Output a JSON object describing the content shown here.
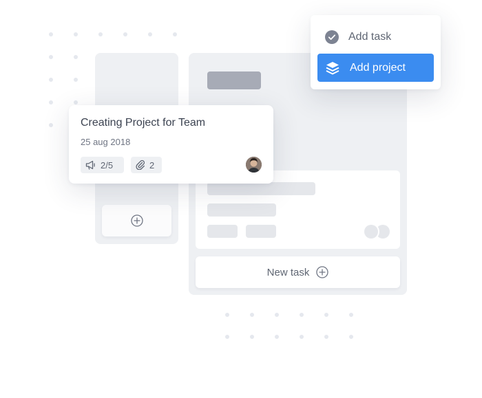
{
  "menu": {
    "items": [
      {
        "label": "Add task",
        "icon": "check-circle-icon"
      },
      {
        "label": "Add project",
        "icon": "layers-icon",
        "active": true
      }
    ]
  },
  "card": {
    "title": "Creating Project for Team",
    "date": "25 aug 2018",
    "checklist": "2/5",
    "attachments": "2"
  },
  "board": {
    "new_task_label": "New task"
  },
  "colors": {
    "accent": "#3b8cf0",
    "column": "#eef0f3",
    "placeholder": "#e5e7eb"
  }
}
